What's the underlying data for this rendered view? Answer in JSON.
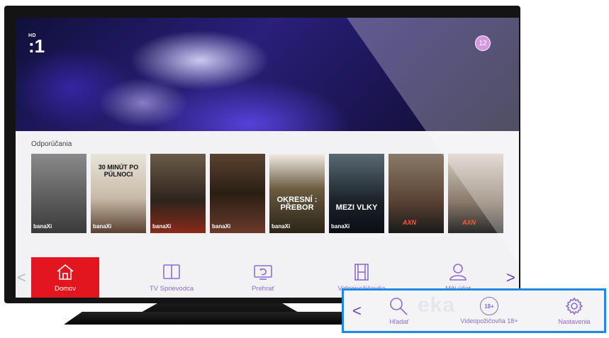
{
  "player": {
    "channel_hd": "HD",
    "channel_logo": ":1",
    "age_rating": "12"
  },
  "recommendations": {
    "title": "Odporúčania",
    "posters": [
      {
        "title": "",
        "badge": "banaXi",
        "bg": "#6b6b6b"
      },
      {
        "title": "30 MINÚT PO PÚLNOCI",
        "badge": "banaXi",
        "bg": "#d9d4c8"
      },
      {
        "title": "",
        "badge": "banaXi",
        "bg": "#4a3a2a"
      },
      {
        "title": "",
        "badge": "banaXi",
        "bg": "#3b2a20"
      },
      {
        "title": "OKRESNÍ : PŘEBOR",
        "badge": "banaXi",
        "bg": "#2e2a24"
      },
      {
        "title": "MEZI VLKY",
        "badge": "banaXi",
        "bg": "#1f2a33"
      },
      {
        "title": "",
        "badge": "AXN",
        "bg": "#6e5a4a"
      },
      {
        "title": "",
        "badge": "AXN",
        "bg": "#b9a89a"
      }
    ]
  },
  "nav": {
    "items": [
      {
        "label": "Domov",
        "icon": "home-icon",
        "active": true
      },
      {
        "label": "TV Sprievodca",
        "icon": "book-icon",
        "active": false
      },
      {
        "label": "Prehrať",
        "icon": "replay-icon",
        "active": false
      },
      {
        "label": "Videopožičovňa",
        "icon": "film-icon",
        "active": false
      },
      {
        "label": "Môj účet",
        "icon": "user-icon",
        "active": false
      }
    ],
    "prev_arrow": "<",
    "next_arrow": ">"
  },
  "more_menu": {
    "back_arrow": "<",
    "ghost_text": "eka",
    "items": [
      {
        "label": "Hľadať",
        "icon": "search-icon"
      },
      {
        "label": "Videopožičovňa 18+",
        "icon": "adult-18-icon",
        "icon_text": "18+"
      },
      {
        "label": "Nastavenia",
        "icon": "gear-icon"
      }
    ]
  },
  "colors": {
    "accent_red": "#e3161f",
    "label_purple": "#8d6bd3",
    "highlight_blue": "#1e88e5"
  }
}
